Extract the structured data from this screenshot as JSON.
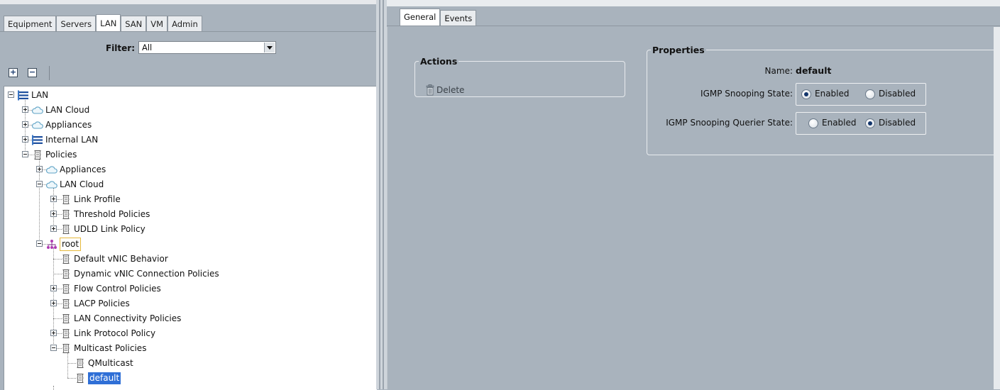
{
  "left": {
    "tabs": [
      {
        "label": "Equipment"
      },
      {
        "label": "Servers"
      },
      {
        "label": "LAN"
      },
      {
        "label": "SAN"
      },
      {
        "label": "VM"
      },
      {
        "label": "Admin"
      }
    ],
    "active_tab": "LAN",
    "filter": {
      "label": "Filter:",
      "value": "All"
    },
    "toolbar": {
      "expand_label": "+",
      "collapse_label": "−"
    },
    "tree": [
      {
        "label": "LAN",
        "depth": 0,
        "expander": "minus",
        "icon": "lan-icon"
      },
      {
        "label": "LAN Cloud",
        "depth": 1,
        "expander": "plus",
        "icon": "cloud-icon"
      },
      {
        "label": "Appliances",
        "depth": 1,
        "expander": "plus",
        "icon": "cloud-icon"
      },
      {
        "label": "Internal LAN",
        "depth": 1,
        "expander": "plus",
        "icon": "lan-icon"
      },
      {
        "label": "Policies",
        "depth": 1,
        "expander": "minus",
        "icon": "policy-icon"
      },
      {
        "label": "Appliances",
        "depth": 2,
        "expander": "plus",
        "icon": "cloud-icon"
      },
      {
        "label": "LAN Cloud",
        "depth": 2,
        "expander": "minus",
        "icon": "cloud-icon"
      },
      {
        "label": "Link Profile",
        "depth": 3,
        "expander": "plus",
        "icon": "policy-icon"
      },
      {
        "label": "Threshold Policies",
        "depth": 3,
        "expander": "plus",
        "icon": "policy-icon"
      },
      {
        "label": "UDLD Link Policy",
        "depth": 3,
        "expander": "plus",
        "icon": "policy-icon"
      },
      {
        "label": "root",
        "depth": 2,
        "expander": "minus",
        "icon": "org-icon",
        "boxed": true
      },
      {
        "label": "Default vNIC Behavior",
        "depth": 3,
        "expander": "none",
        "icon": "policy-icon"
      },
      {
        "label": "Dynamic vNIC Connection Policies",
        "depth": 3,
        "expander": "none",
        "icon": "policy-icon"
      },
      {
        "label": "Flow Control Policies",
        "depth": 3,
        "expander": "plus",
        "icon": "policy-icon"
      },
      {
        "label": "LACP Policies",
        "depth": 3,
        "expander": "plus",
        "icon": "policy-icon"
      },
      {
        "label": "LAN Connectivity Policies",
        "depth": 3,
        "expander": "none",
        "icon": "policy-icon"
      },
      {
        "label": "Link Protocol Policy",
        "depth": 3,
        "expander": "plus",
        "icon": "policy-icon"
      },
      {
        "label": "Multicast Policies",
        "depth": 3,
        "expander": "minus",
        "icon": "policy-icon"
      },
      {
        "label": "QMulticast",
        "depth": 4,
        "expander": "none",
        "icon": "policy-icon"
      },
      {
        "label": "default",
        "depth": 4,
        "expander": "none",
        "icon": "policy-icon",
        "selected": true
      }
    ]
  },
  "right": {
    "tabs": [
      {
        "label": "General"
      },
      {
        "label": "Events"
      }
    ],
    "active_tab": "General",
    "actions": {
      "title": "Actions",
      "delete_label": "Delete"
    },
    "properties": {
      "title": "Properties",
      "name_label": "Name:",
      "name_value": "default",
      "igmp_snooping_label": "IGMP Snooping State:",
      "igmp_querier_label": "IGMP Snooping Querier State:",
      "enabled_label": "Enabled",
      "disabled_label": "Disabled",
      "igmp_snooping_state": "Enabled",
      "igmp_querier_state": "Disabled"
    }
  },
  "colors": {
    "panel_bg": "#a9b3bd",
    "selection": "#2f6fd6",
    "lan_icon": "#1e4f9e",
    "org_icon": "#9b2f9f"
  }
}
